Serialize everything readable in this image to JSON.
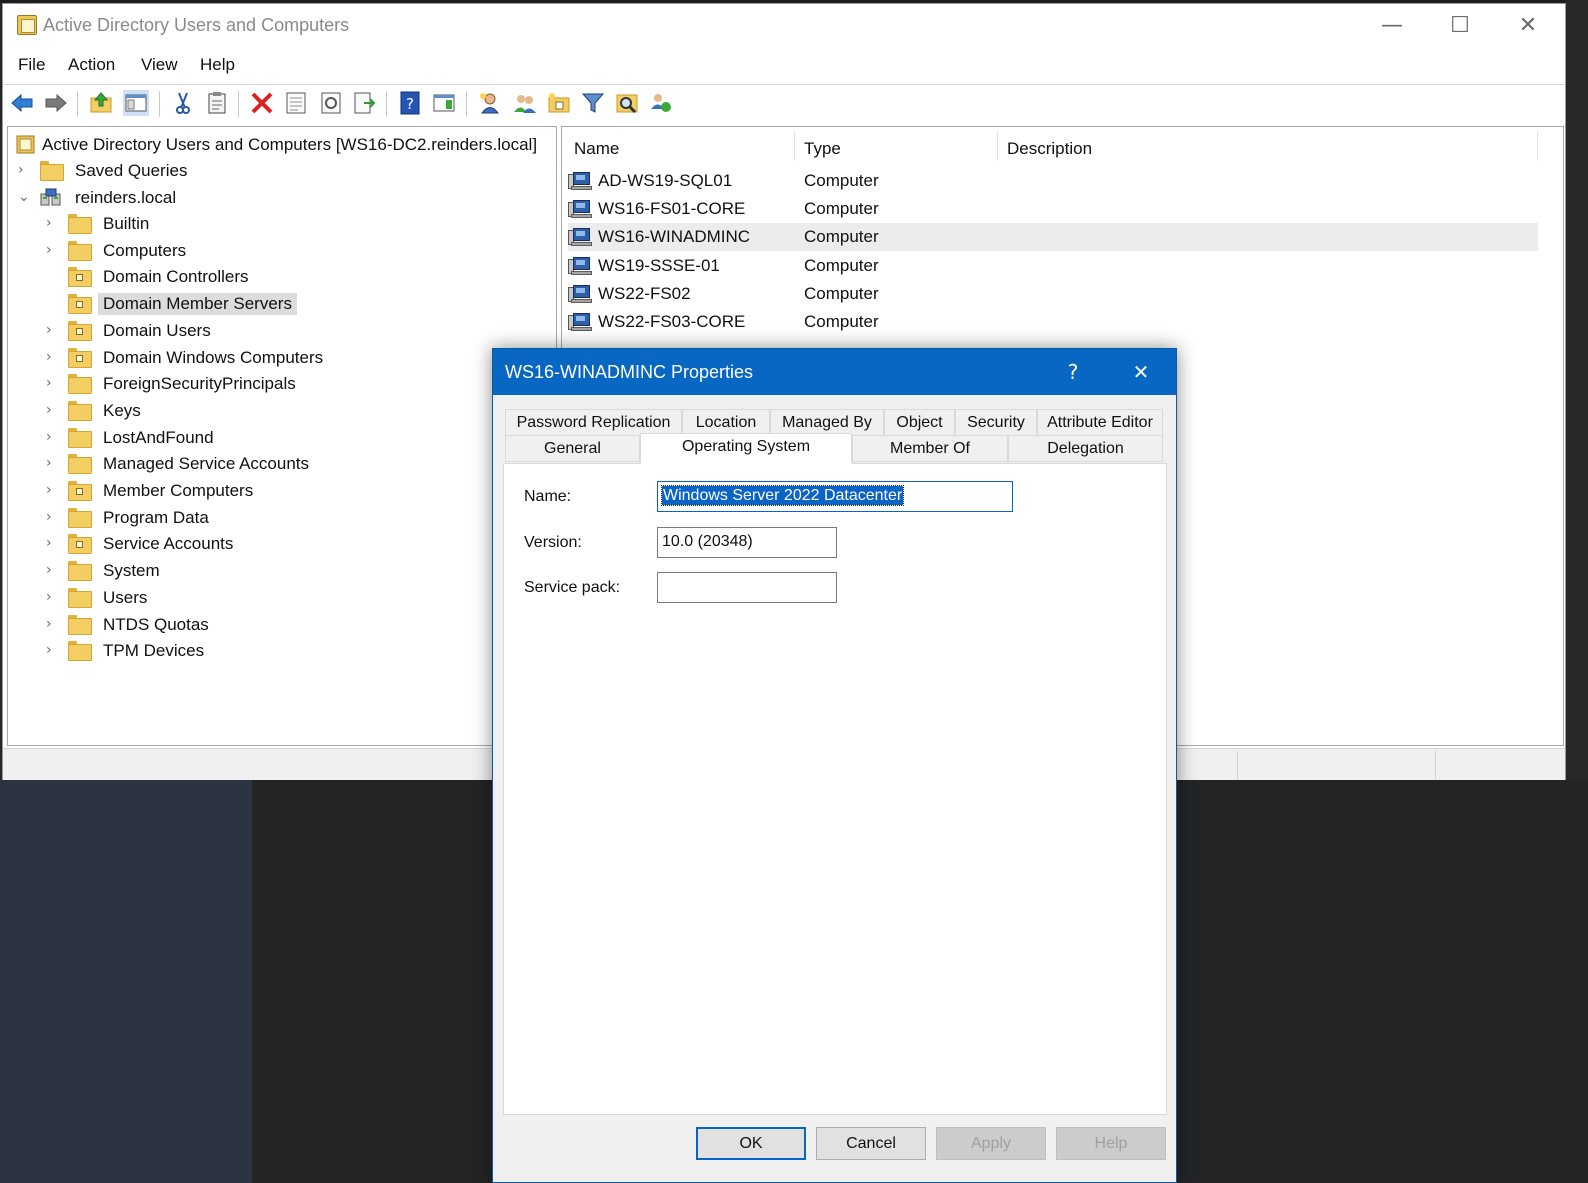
{
  "window": {
    "title": "Active Directory Users and Computers",
    "controls": {
      "minimize": "—",
      "maximize": "☐",
      "close": "✕"
    }
  },
  "menu": [
    "File",
    "Action",
    "View",
    "Help"
  ],
  "toolbar": {
    "icons": [
      "back-icon",
      "forward-icon",
      "up-one-level-icon",
      "show-hide-console-tree-icon",
      "cut-icon",
      "copy-icon",
      "delete-icon",
      "properties-icon",
      "refresh-icon",
      "export-list-icon",
      "help-icon",
      "show-hide-action-pane-icon",
      "new-user-icon",
      "new-group-icon",
      "new-ou-icon",
      "filter-icon",
      "find-icon",
      "add-to-group-icon"
    ]
  },
  "tree": {
    "root": "Active Directory Users and Computers [WS16-DC2.reinders.local]",
    "top_items": [
      {
        "label": "Saved Queries",
        "chevron": "›",
        "type": "folder"
      },
      {
        "label": "reinders.local",
        "chevron": "⌄",
        "type": "domain"
      }
    ],
    "children": [
      {
        "label": "Builtin",
        "chevron": "›",
        "type": "folder",
        "selected": false
      },
      {
        "label": "Computers",
        "chevron": "›",
        "type": "folder",
        "selected": false
      },
      {
        "label": "Domain Controllers",
        "chevron": "",
        "type": "ou",
        "selected": false
      },
      {
        "label": "Domain Member Servers",
        "chevron": "",
        "type": "ou",
        "selected": true
      },
      {
        "label": "Domain Users",
        "chevron": "›",
        "type": "ou",
        "selected": false
      },
      {
        "label": "Domain Windows Computers",
        "chevron": "›",
        "type": "ou",
        "selected": false
      },
      {
        "label": "ForeignSecurityPrincipals",
        "chevron": "›",
        "type": "folder",
        "selected": false
      },
      {
        "label": "Keys",
        "chevron": "›",
        "type": "folder",
        "selected": false
      },
      {
        "label": "LostAndFound",
        "chevron": "›",
        "type": "folder",
        "selected": false
      },
      {
        "label": "Managed Service Accounts",
        "chevron": "›",
        "type": "folder",
        "selected": false
      },
      {
        "label": "Member Computers",
        "chevron": "›",
        "type": "ou",
        "selected": false
      },
      {
        "label": "Program Data",
        "chevron": "›",
        "type": "folder",
        "selected": false
      },
      {
        "label": "Service Accounts",
        "chevron": "›",
        "type": "ou",
        "selected": false
      },
      {
        "label": "System",
        "chevron": "›",
        "type": "folder",
        "selected": false
      },
      {
        "label": "Users",
        "chevron": "›",
        "type": "folder",
        "selected": false
      },
      {
        "label": "NTDS Quotas",
        "chevron": "›",
        "type": "folder",
        "selected": false
      },
      {
        "label": "TPM Devices",
        "chevron": "›",
        "type": "folder",
        "selected": false
      }
    ]
  },
  "list": {
    "columns": [
      "Name",
      "Type",
      "Description"
    ],
    "rows": [
      {
        "name": "AD-WS19-SQL01",
        "type": "Computer",
        "selected": false
      },
      {
        "name": "WS16-FS01-CORE",
        "type": "Computer",
        "selected": false
      },
      {
        "name": "WS16-WINADMINC",
        "type": "Computer",
        "selected": true
      },
      {
        "name": "WS19-SSSE-01",
        "type": "Computer",
        "selected": false
      },
      {
        "name": "WS22-FS02",
        "type": "Computer",
        "selected": false
      },
      {
        "name": "WS22-FS03-CORE",
        "type": "Computer",
        "selected": false
      }
    ]
  },
  "dialog": {
    "title": "WS16-WINADMINC Properties",
    "help_glyph": "?",
    "close_glyph": "✕",
    "tabs_row1": [
      "Password Replication",
      "Location",
      "Managed By",
      "Object",
      "Security",
      "Attribute Editor"
    ],
    "tabs_row2": [
      "General",
      "Operating System",
      "Member Of",
      "Delegation"
    ],
    "active_tab": "Operating System",
    "fields": {
      "name_label": "Name:",
      "name_value": "Windows Server 2022 Datacenter",
      "version_label": "Version:",
      "version_value": "10.0 (20348)",
      "service_pack_label": "Service pack:",
      "service_pack_value": ""
    },
    "buttons": {
      "ok": "OK",
      "cancel": "Cancel",
      "apply": "Apply",
      "help": "Help"
    }
  }
}
